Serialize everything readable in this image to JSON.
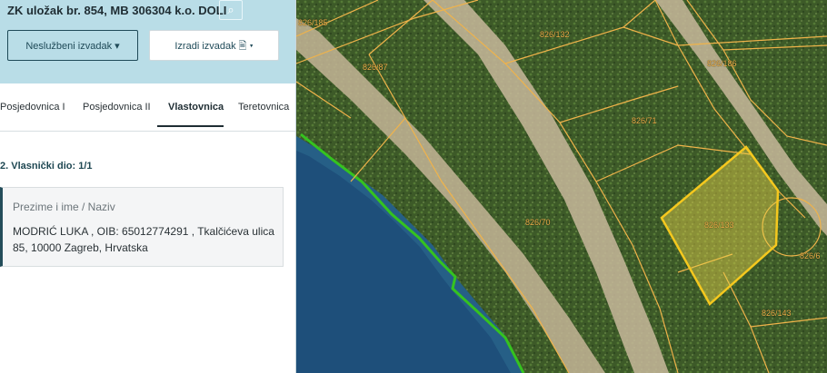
{
  "header": {
    "title": "ZK uložak br. 854, MB 306304 k.o. DOLI",
    "search_icon": "search-icon",
    "btn_unofficial": "Neslužbeni izvadak ▾",
    "btn_create": "Izradi izvadak 🖹 ▾"
  },
  "tabs": [
    {
      "label": "Posjedovnica I"
    },
    {
      "label": "Posjedovnica II"
    },
    {
      "label": "Vlastovnica"
    },
    {
      "label": "Teretovnica"
    }
  ],
  "content": {
    "section_title": "2. Vlasnički dio: 1/1",
    "card_label": "Prezime i ime / Naziv",
    "card_value": "MODRIĆ LUKA , OIB: 65012774291 , Tkalčićeva ulica 85, 10000 Zagreb, Hrvatska"
  },
  "map": {
    "parcels": [
      "826/185",
      "826/87",
      "826/132",
      "826/186",
      "826/71",
      "826/70",
      "826/133",
      "826/6",
      "826/143"
    ],
    "colors": {
      "parcel_border": "#f0b34a",
      "selected_fill": "#e9d24a",
      "sea": "#1f4f7a",
      "forest": "#3f5a2a",
      "road": "#c6b899",
      "coastline": "#35c31f"
    }
  }
}
